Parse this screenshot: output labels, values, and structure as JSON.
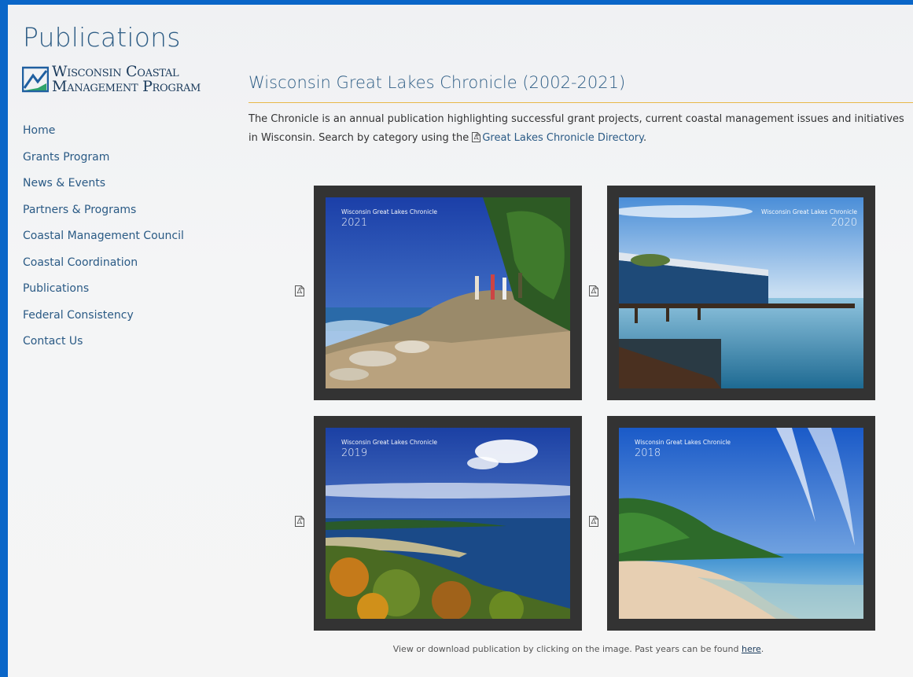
{
  "header": {
    "title": "Publications",
    "logo_line1": "Wisconsin Coastal",
    "logo_line2": "Management Program"
  },
  "nav": {
    "items": [
      {
        "label": "Home"
      },
      {
        "label": "Grants Program"
      },
      {
        "label": "News & Events"
      },
      {
        "label": "Partners & Programs"
      },
      {
        "label": "Coastal Management Council"
      },
      {
        "label": "Coastal Coordination"
      },
      {
        "label": "Publications"
      },
      {
        "label": "Federal Consistency"
      },
      {
        "label": "Contact Us"
      }
    ]
  },
  "main": {
    "title": "Wisconsin Great Lakes Chronicle (2002-2021)",
    "intro_text": "The Chronicle is an annual publication highlighting successful grant projects, current coastal management issues and initiatives in Wisconsin. Search by category using the",
    "directory_link": "Great Lakes Chronicle Directory",
    "intro_end": ".",
    "covers": [
      {
        "label": "Wisconsin Great Lakes Chronicle",
        "year": "2021"
      },
      {
        "label": "Wisconsin Great Lakes Chronicle",
        "year": "2020"
      },
      {
        "label": "Wisconsin Great Lakes Chronicle",
        "year": "2019"
      },
      {
        "label": "Wisconsin Great Lakes Chronicle",
        "year": "2018"
      }
    ]
  },
  "footer": {
    "note": "View or download publication by clicking on the image. Past years can be found",
    "link": "here",
    "end": "."
  },
  "colors": {
    "frame": "#0a66c8",
    "heading": "#2f5e86",
    "rule": "#e8b94a",
    "card": "#333333"
  },
  "icons": [
    "pdf-icon",
    "logo-mark"
  ]
}
